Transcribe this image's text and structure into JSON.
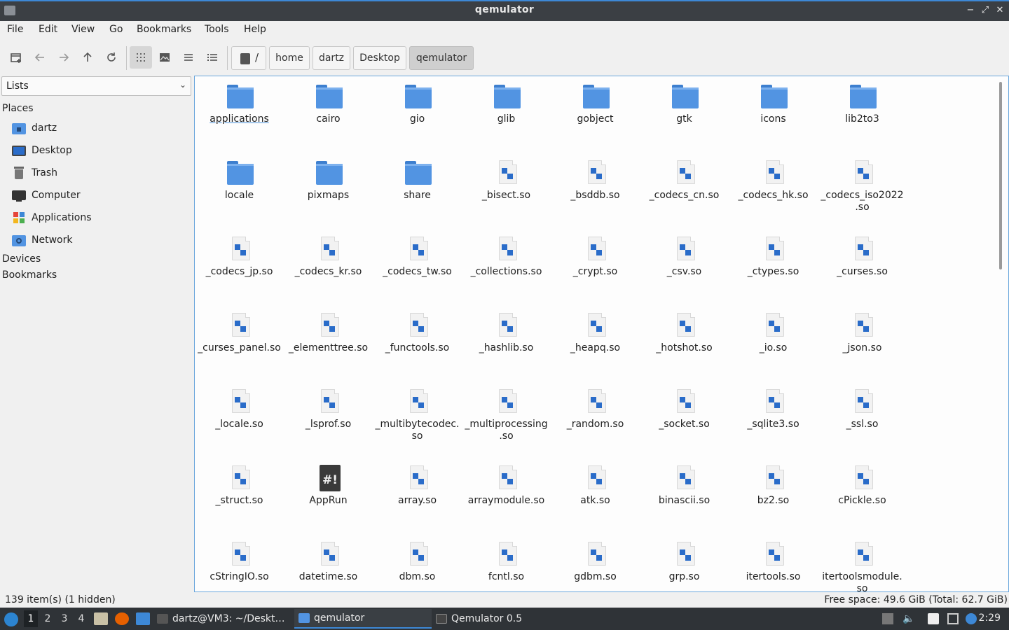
{
  "window": {
    "title": "qemulator"
  },
  "menu": [
    "File",
    "Edit",
    "View",
    "Go",
    "Bookmarks",
    "Tools",
    "Help"
  ],
  "breadcrumbs": {
    "root": "/",
    "items": [
      "home",
      "dartz",
      "Desktop",
      "qemulator"
    ]
  },
  "side": {
    "selector": "Lists",
    "places_heading": "Places",
    "places": [
      {
        "label": "dartz",
        "icon": "home-folder-icon"
      },
      {
        "label": "Desktop",
        "icon": "desktop-icon"
      },
      {
        "label": "Trash",
        "icon": "trash-icon"
      },
      {
        "label": "Computer",
        "icon": "computer-icon"
      },
      {
        "label": "Applications",
        "icon": "applications-icon"
      },
      {
        "label": "Network",
        "icon": "network-icon"
      }
    ],
    "devices_heading": "Devices",
    "bookmarks_heading": "Bookmarks"
  },
  "files": [
    {
      "name": "applications",
      "type": "folder"
    },
    {
      "name": "cairo",
      "type": "folder"
    },
    {
      "name": "gio",
      "type": "folder"
    },
    {
      "name": "glib",
      "type": "folder"
    },
    {
      "name": "gobject",
      "type": "folder"
    },
    {
      "name": "gtk",
      "type": "folder"
    },
    {
      "name": "icons",
      "type": "folder"
    },
    {
      "name": "lib2to3",
      "type": "folder"
    },
    {
      "name": "locale",
      "type": "folder"
    },
    {
      "name": "pixmaps",
      "type": "folder"
    },
    {
      "name": "share",
      "type": "folder"
    },
    {
      "name": "_bisect.so",
      "type": "file"
    },
    {
      "name": "_bsddb.so",
      "type": "file"
    },
    {
      "name": "_codecs_cn.so",
      "type": "file"
    },
    {
      "name": "_codecs_hk.so",
      "type": "file"
    },
    {
      "name": "_codecs_iso2022\n.so",
      "type": "file"
    },
    {
      "name": "_codecs_jp.so",
      "type": "file"
    },
    {
      "name": "_codecs_kr.so",
      "type": "file"
    },
    {
      "name": "_codecs_tw.so",
      "type": "file"
    },
    {
      "name": "_collections.so",
      "type": "file"
    },
    {
      "name": "_crypt.so",
      "type": "file"
    },
    {
      "name": "_csv.so",
      "type": "file"
    },
    {
      "name": "_ctypes.so",
      "type": "file"
    },
    {
      "name": "_curses.so",
      "type": "file"
    },
    {
      "name": "_curses_panel.so",
      "type": "file"
    },
    {
      "name": "_elementtree.so",
      "type": "file"
    },
    {
      "name": "_functools.so",
      "type": "file"
    },
    {
      "name": "_hashlib.so",
      "type": "file"
    },
    {
      "name": "_heapq.so",
      "type": "file"
    },
    {
      "name": "_hotshot.so",
      "type": "file"
    },
    {
      "name": "_io.so",
      "type": "file"
    },
    {
      "name": "_json.so",
      "type": "file"
    },
    {
      "name": "_locale.so",
      "type": "file"
    },
    {
      "name": "_lsprof.so",
      "type": "file"
    },
    {
      "name": "_multibytecodec.\nso",
      "type": "file"
    },
    {
      "name": "_multiprocessing\n.so",
      "type": "file"
    },
    {
      "name": "_random.so",
      "type": "file"
    },
    {
      "name": "_socket.so",
      "type": "file"
    },
    {
      "name": "_sqlite3.so",
      "type": "file"
    },
    {
      "name": "_ssl.so",
      "type": "file"
    },
    {
      "name": "_struct.so",
      "type": "file"
    },
    {
      "name": "AppRun",
      "type": "script"
    },
    {
      "name": "array.so",
      "type": "file"
    },
    {
      "name": "arraymodule.so",
      "type": "file"
    },
    {
      "name": "atk.so",
      "type": "file"
    },
    {
      "name": "binascii.so",
      "type": "file"
    },
    {
      "name": "bz2.so",
      "type": "file"
    },
    {
      "name": "cPickle.so",
      "type": "file"
    },
    {
      "name": "cStringIO.so",
      "type": "file"
    },
    {
      "name": "datetime.so",
      "type": "file"
    },
    {
      "name": "dbm.so",
      "type": "file"
    },
    {
      "name": "fcntl.so",
      "type": "file"
    },
    {
      "name": "gdbm.so",
      "type": "file"
    },
    {
      "name": "grp.so",
      "type": "file"
    },
    {
      "name": "itertools.so",
      "type": "file"
    },
    {
      "name": "itertoolsmodule.\nso",
      "type": "file"
    }
  ],
  "status": {
    "items": "139 item(s) (1 hidden)",
    "free_space": "Free space: 49.6 GiB (Total: 62.7 GiB)"
  },
  "taskbar": {
    "workspaces": [
      "1",
      "2",
      "3",
      "4"
    ],
    "tasks": [
      "dartz@VM3: ~/Deskt…",
      "qemulator",
      "Qemulator 0.5"
    ],
    "clock": "2:29"
  },
  "colors": {
    "accent": "#3d88d6",
    "folder": "#5294e2",
    "taskbar": "#2f3337"
  }
}
